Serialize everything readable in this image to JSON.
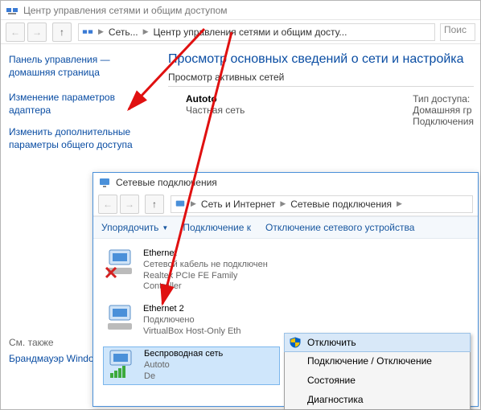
{
  "win1": {
    "title": "Центр управления сетями и общим доступом",
    "breadcrumb": [
      "Сеть...",
      "Центр управления сетями и общим досту..."
    ],
    "search_placeholder": "Поис",
    "sidebar": {
      "home": "Панель управления — домашняя страница",
      "links": [
        "Изменение параметров адаптера",
        "Изменить дополнительные параметры общего доступа"
      ],
      "footer_label": "См. также",
      "footer_link": "Брандмауэр Windows"
    },
    "main": {
      "title": "Просмотр основных сведений о сети и настройка",
      "active_label": "Просмотр активных сетей",
      "net_name": "Autoto",
      "net_kind": "Частная сеть",
      "right": {
        "access_label": "Тип доступа:",
        "homegroup_label": "Домашняя гр",
        "connections_label": "Подключения"
      }
    }
  },
  "win2": {
    "title": "Сетевые подключения",
    "breadcrumb": [
      "Сеть и Интернет",
      "Сетевые подключения"
    ],
    "toolbar": {
      "organize": "Упорядочить",
      "connect": "Подключение к",
      "disable": "Отключение сетевого устройства"
    },
    "connections": [
      {
        "name": "Ethernet",
        "status": "Сетевой кабель не подключен",
        "device": "Realtek PCIe FE Family Controller",
        "disconnected": true
      },
      {
        "name": "Ethernet 2",
        "status": "Подключено",
        "device": "VirtualBox Host-Only Eth",
        "disconnected": false
      },
      {
        "name": "Беспроводная сеть",
        "status": "Autoto",
        "device": "De",
        "disconnected": false,
        "wireless": true,
        "selected": true
      }
    ]
  },
  "ctx": {
    "items": [
      "Отключить",
      "Подключение / Отключение",
      "Состояние",
      "Диагностика"
    ]
  }
}
